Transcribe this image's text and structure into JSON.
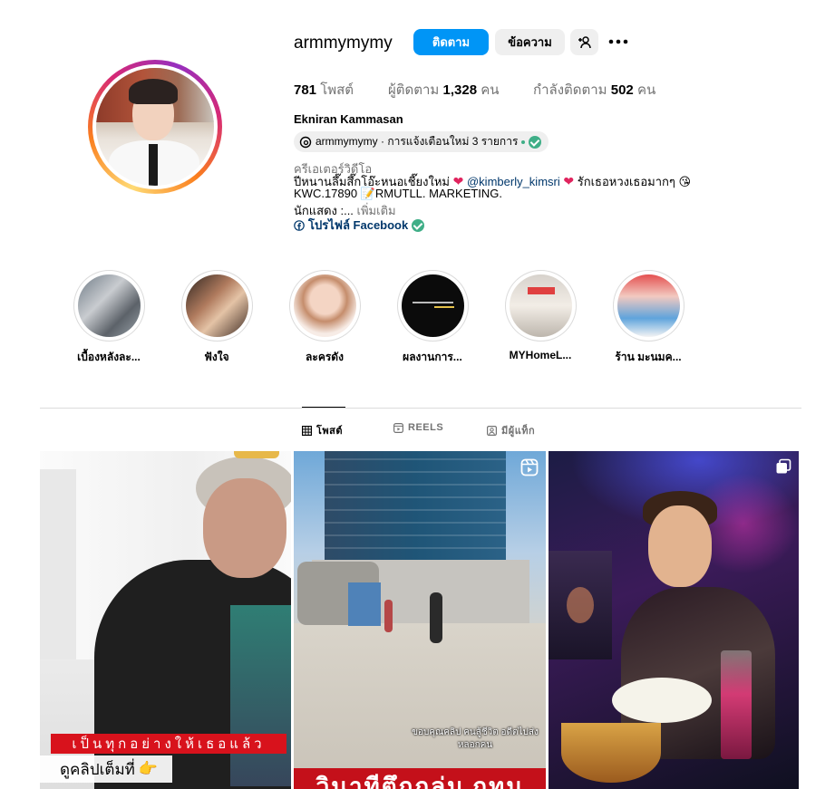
{
  "profile": {
    "username": "armmymymy",
    "follow_label": "ติดตาม",
    "message_label": "ข้อความ",
    "posts_count": "781",
    "posts_label": "โพสต์",
    "followers_label": "ผู้ติดตาม",
    "followers_count": "1,328",
    "followers_unit": "คน",
    "following_label": "กำลังติดตาม",
    "following_count": "502",
    "following_unit": "คน",
    "full_name": "Ekniran Kammasan",
    "threads_text": "armmymymy · การแจ้งเตือนใหม่ 3 รายการ",
    "category": "ครีเอเตอร์วิดีโอ",
    "bio_line1_a": "ปีหนานลึ๊มสึ๊กโอ๊ะหนอเชี๊ยงใหม่",
    "bio_line1_mention": "@kimberly_kimsri",
    "bio_line1_b": "รักเธอหวงเธอมากๆ",
    "bio_line1_emoji": "😘",
    "bio_line2_a": "KWC.17890",
    "bio_line2_emoji": "📝",
    "bio_line2_b": "RMUTLL. MARKETING.",
    "bio_line3": "นักแสดง :...",
    "bio_more": "เพิ่มเติม",
    "facebook_link": "โปรไฟล์ Facebook"
  },
  "highlights": [
    {
      "label": "เบื้องหลังละ..."
    },
    {
      "label": "ฟังใจ"
    },
    {
      "label": "ละครดัง"
    },
    {
      "label": "ผลงานการ..."
    },
    {
      "label": "MYHomeL..."
    },
    {
      "label": "ร้าน มะนมค..."
    }
  ],
  "tabs": {
    "posts": "โพสต์",
    "reels": "REELS",
    "tagged": "มีผู้แท็ก"
  },
  "posts": [
    {
      "caption_red": "เป็นทุกอย่างให้เธอแล้ว",
      "caption_white": "ดูคลิปเต็มที่",
      "caption_emoji": "👉"
    },
    {
      "subtitle": "ขอบคุณคลิป คนสู้ชีวิต อดีตไปส่งหลอกคน",
      "banner": "วินาทีตึกถล่ม กทม"
    },
    {}
  ],
  "colors": {
    "follow_button": "#0095f6",
    "secondary_button": "#efefef",
    "link": "#00376b",
    "muted": "#737373",
    "verified": "#3fae87"
  }
}
